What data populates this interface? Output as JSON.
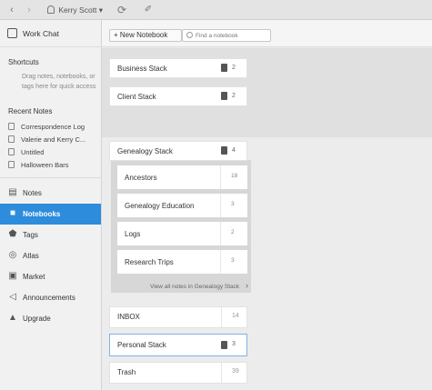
{
  "toolbar": {
    "back_icon": "chevron-left-icon",
    "forward_icon": "chevron-right-icon",
    "user_name": "Kerry Scott",
    "user_caret": "▾",
    "sync_icon": "sync-icon",
    "activity_icon": "activity-icon"
  },
  "sidebar": {
    "work_chat": "Work Chat",
    "shortcuts_title": "Shortcuts",
    "shortcuts_hint": "Drag notes, notebooks, or tags here for quick access",
    "recent_title": "Recent Notes",
    "recent_notes": [
      "Correspondence Log",
      "Valerie and Kerry C...",
      "Untitled",
      "Halloween Bars"
    ],
    "nav": [
      {
        "label": "Notes",
        "icon": "notes-icon"
      },
      {
        "label": "Notebooks",
        "icon": "notebook-icon",
        "active": true
      },
      {
        "label": "Tags",
        "icon": "tag-icon"
      },
      {
        "label": "Atlas",
        "icon": "globe-icon"
      },
      {
        "label": "Market",
        "icon": "market-icon"
      },
      {
        "label": "Announcements",
        "icon": "megaphone-icon"
      },
      {
        "label": "Upgrade",
        "icon": "upgrade-icon"
      }
    ]
  },
  "main": {
    "new_notebook": "+ New Notebook",
    "search_placeholder": "Find a notebook",
    "stacks_top": [
      {
        "name": "Business Stack",
        "count": "2"
      },
      {
        "name": "Client Stack",
        "count": "2"
      }
    ],
    "genealogy": {
      "name": "Genealogy Stack",
      "count": "4",
      "notebooks": [
        {
          "name": "Ancestors",
          "count": "18"
        },
        {
          "name": "Genealogy Education",
          "count": "3"
        },
        {
          "name": "Logs",
          "count": "2"
        },
        {
          "name": "Research Trips",
          "count": "3"
        }
      ],
      "view_all": "View all notes in Genealogy Stack",
      "view_all_arrow": "›"
    },
    "inbox": {
      "name": "INBOX",
      "count": "14"
    },
    "personal_stack": {
      "name": "Personal Stack",
      "count": "3"
    },
    "trash": {
      "name": "Trash",
      "count": "39"
    }
  },
  "colors": {
    "accent": "#2d8cdb",
    "selection_border": "#7fb3e6"
  }
}
